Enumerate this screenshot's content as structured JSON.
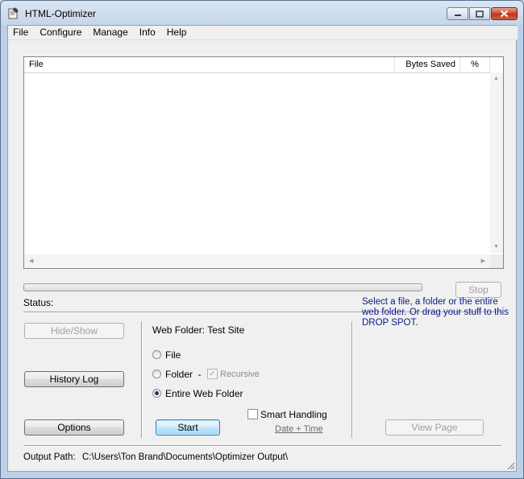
{
  "window": {
    "title": "HTML-Optimizer"
  },
  "icons": {
    "app": "app-icon",
    "minimize": "minimize-icon",
    "maximize": "maximize-icon",
    "close": "close-icon",
    "grip": "resize-grip-icon"
  },
  "colors": {
    "progress": "#4fc04f",
    "drop_text": "#0a1a8a",
    "close_button": "#c9452c"
  },
  "menu": [
    "File",
    "Configure",
    "Manage",
    "Info",
    "Help"
  ],
  "table": {
    "columns": [
      "File",
      "Bytes Saved",
      "%"
    ],
    "rows": []
  },
  "progress": {
    "value": 0
  },
  "buttons": {
    "stop": "Stop",
    "hide_show": "Hide/Show",
    "history_log": "History Log",
    "options": "Options",
    "start": "Start",
    "view_page": "View Page"
  },
  "status": {
    "label": "Status:"
  },
  "web_folder": {
    "label": "Web Folder: Test Site"
  },
  "mode": {
    "file": "File",
    "folder": "Folder  -",
    "recursive": "Recursive",
    "entire": "Entire Web Folder",
    "selected": "entire"
  },
  "smart_handling": {
    "label": "Smart Handling",
    "checked": false,
    "date_time_link": "Date + Time"
  },
  "drop_spot": {
    "text": "Select a file, a folder or the entire web folder. Or drag your stuff to this DROP SPOT."
  },
  "output": {
    "label": "Output Path:",
    "path": "C:\\Users\\Ton Brand\\Documents\\Optimizer Output\\"
  }
}
